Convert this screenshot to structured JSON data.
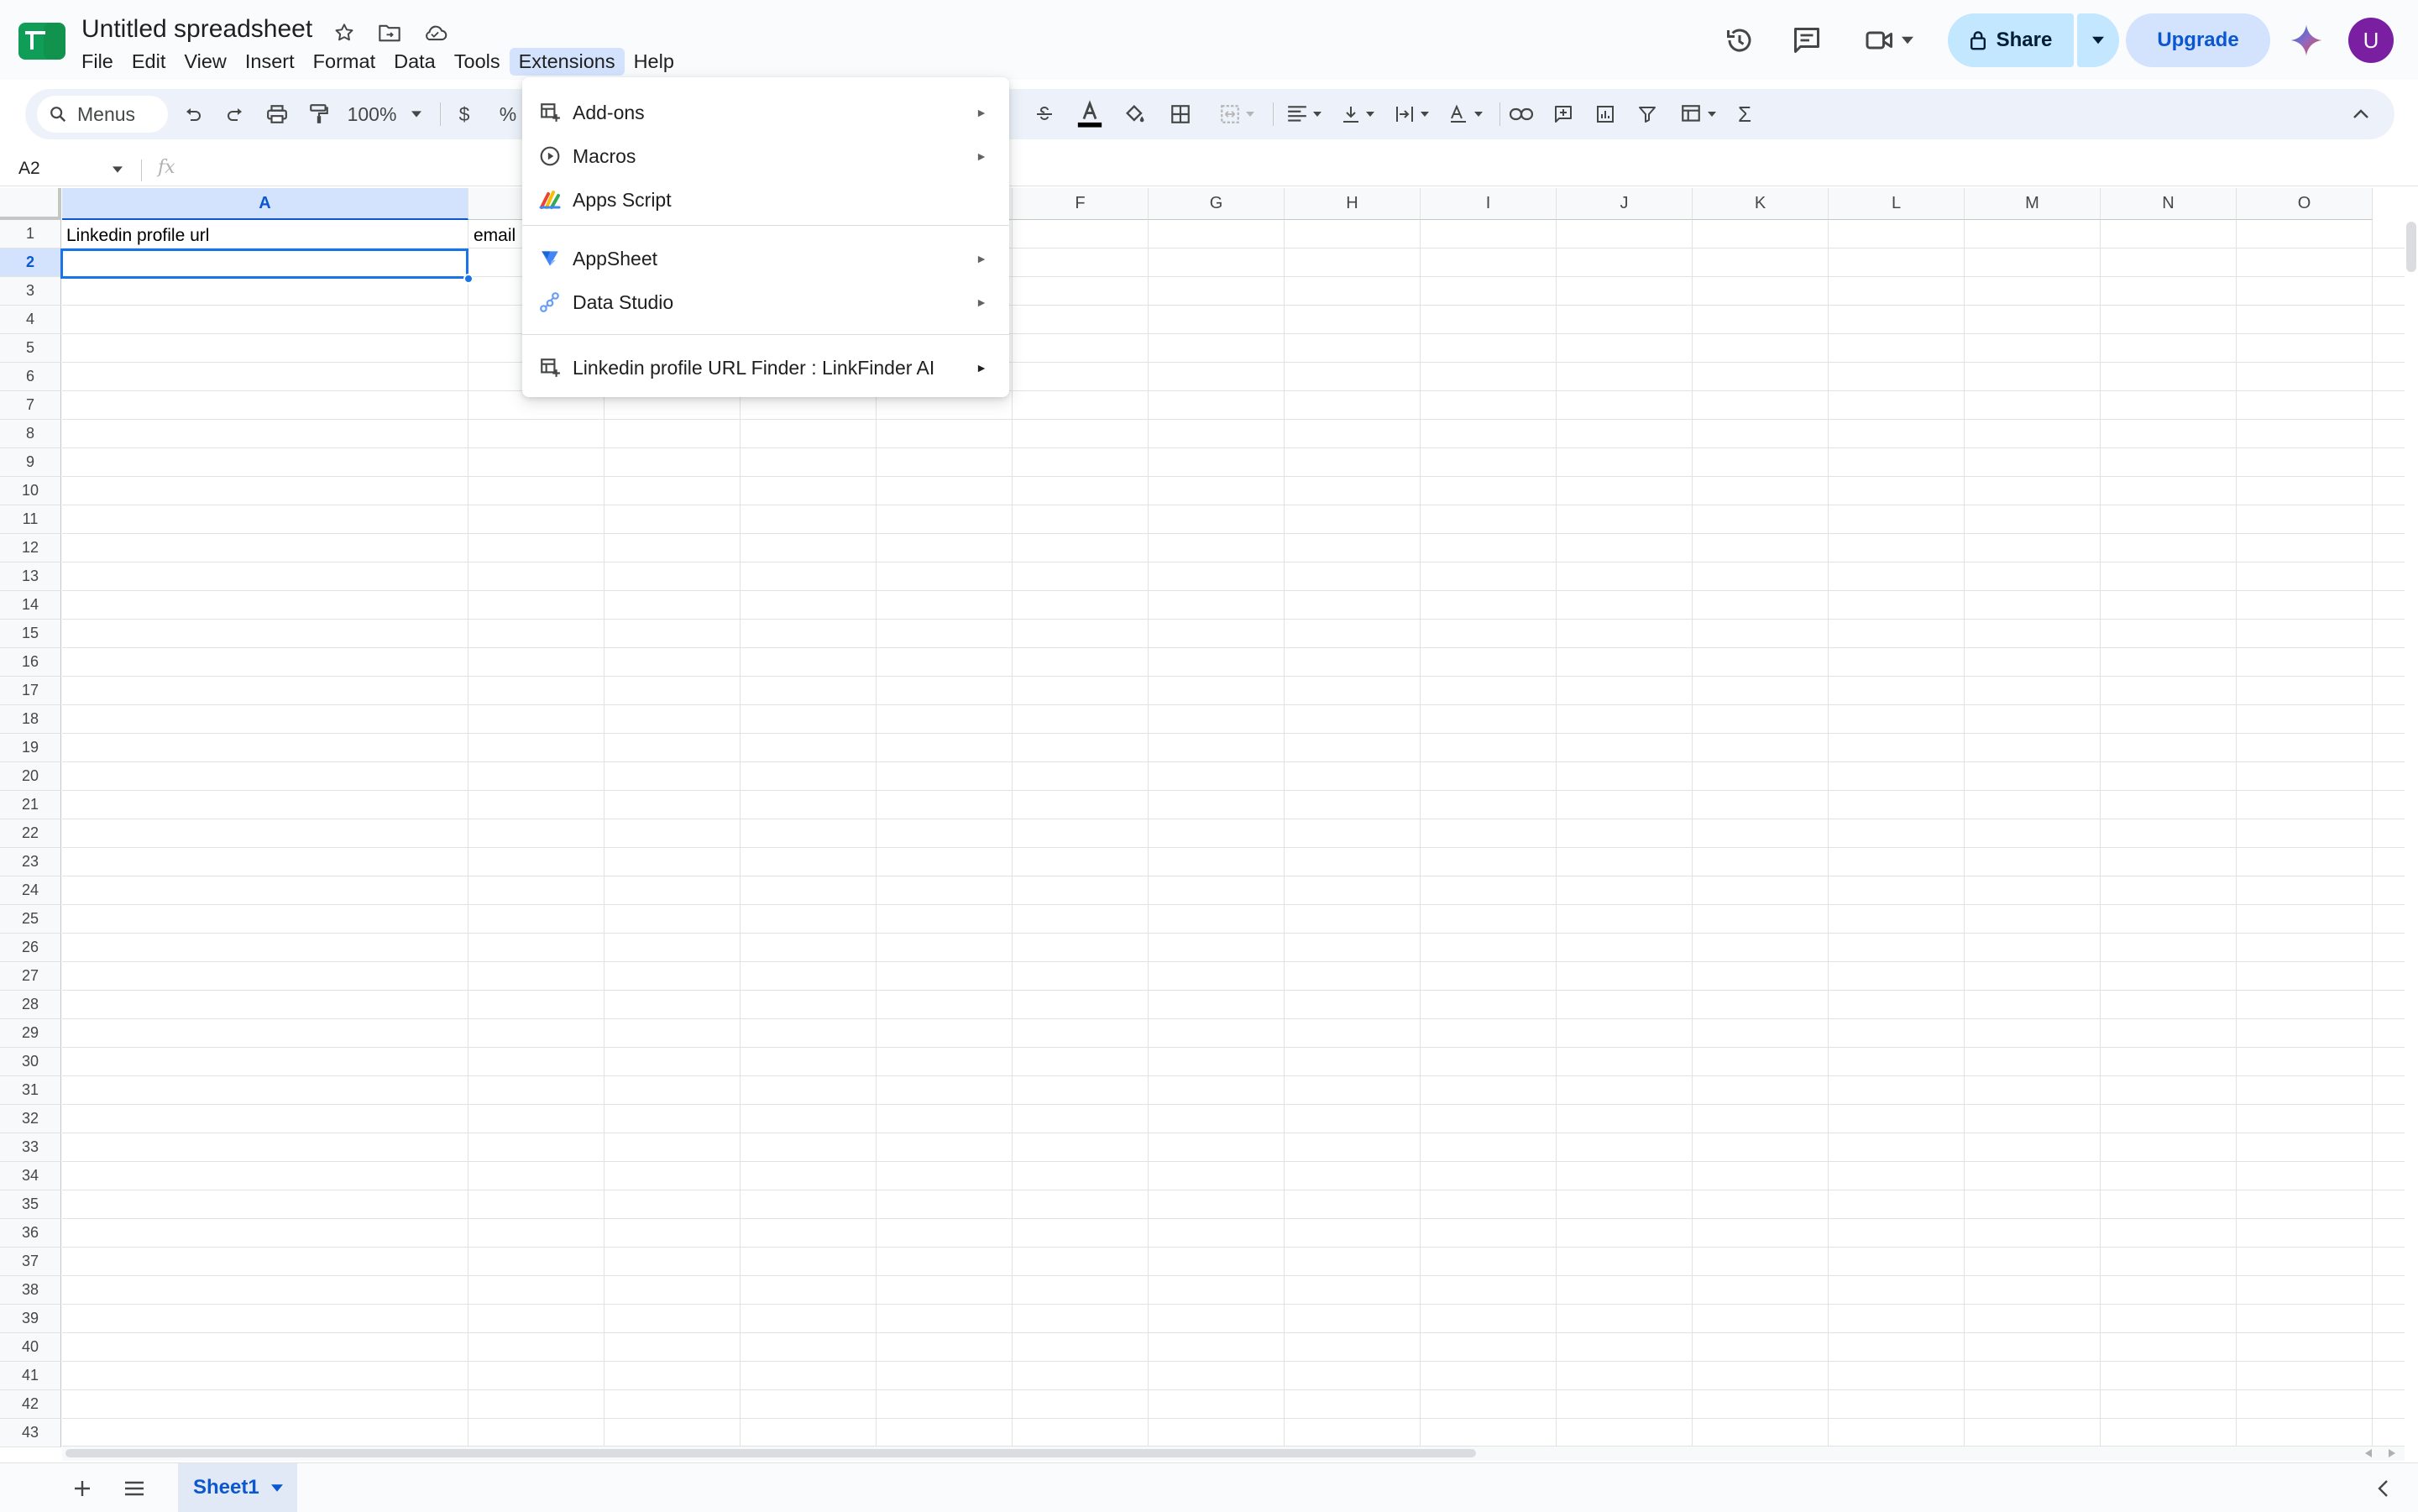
{
  "app": {
    "doc_title": "Untitled spreadsheet",
    "menus": [
      "File",
      "Edit",
      "View",
      "Insert",
      "Format",
      "Data",
      "Tools",
      "Extensions",
      "Help"
    ],
    "active_menu": "Extensions"
  },
  "header": {
    "share_label": "Share",
    "upgrade_label": "Upgrade",
    "avatar_initial": "U",
    "accent": "#c2e7ff"
  },
  "toolbar": {
    "search_label": "Menus",
    "zoom": "100%",
    "currency_symbol": "$",
    "percent_symbol": "%",
    "sum_symbol": "Σ"
  },
  "formula_bar": {
    "name_box": "A2",
    "fx_label": "fx"
  },
  "grid": {
    "columns": [
      "A",
      "",
      "",
      "",
      "",
      "F",
      "G",
      "H",
      "I",
      "J",
      "K",
      "L",
      "M",
      "N",
      "O"
    ],
    "selected_column": "A",
    "rows": [
      "1",
      "2",
      "3",
      "4",
      "5",
      "6",
      "7",
      "8",
      "9",
      "10",
      "11",
      "12",
      "13",
      "14",
      "15",
      "16",
      "17",
      "18",
      "19",
      "20",
      "21",
      "22",
      "23",
      "24",
      "25",
      "26",
      "27",
      "28",
      "29",
      "30",
      "31",
      "32",
      "33",
      "34",
      "35",
      "36",
      "37",
      "38",
      "39",
      "40",
      "41",
      "42",
      "43"
    ],
    "selected_row": "2",
    "cells": {
      "A1": "Linkedin profile url",
      "B1": "email"
    }
  },
  "extensions_menu": {
    "items": [
      {
        "label": "Add-ons",
        "icon": "addons-icon",
        "submenu": true
      },
      {
        "label": "Macros",
        "icon": "macros-icon",
        "submenu": true
      },
      {
        "label": "Apps Script",
        "icon": "apps-script-icon",
        "submenu": false
      },
      {
        "label": "AppSheet",
        "icon": "appsheet-icon",
        "submenu": true
      },
      {
        "label": "Data Studio",
        "icon": "data-studio-icon",
        "submenu": true
      },
      {
        "label": "Linkedin profile URL Finder : LinkFinder AI",
        "icon": "addon-app-icon",
        "submenu": true
      }
    ],
    "submenu_arrow": "►"
  },
  "sheets": {
    "active_tab": "Sheet1"
  }
}
